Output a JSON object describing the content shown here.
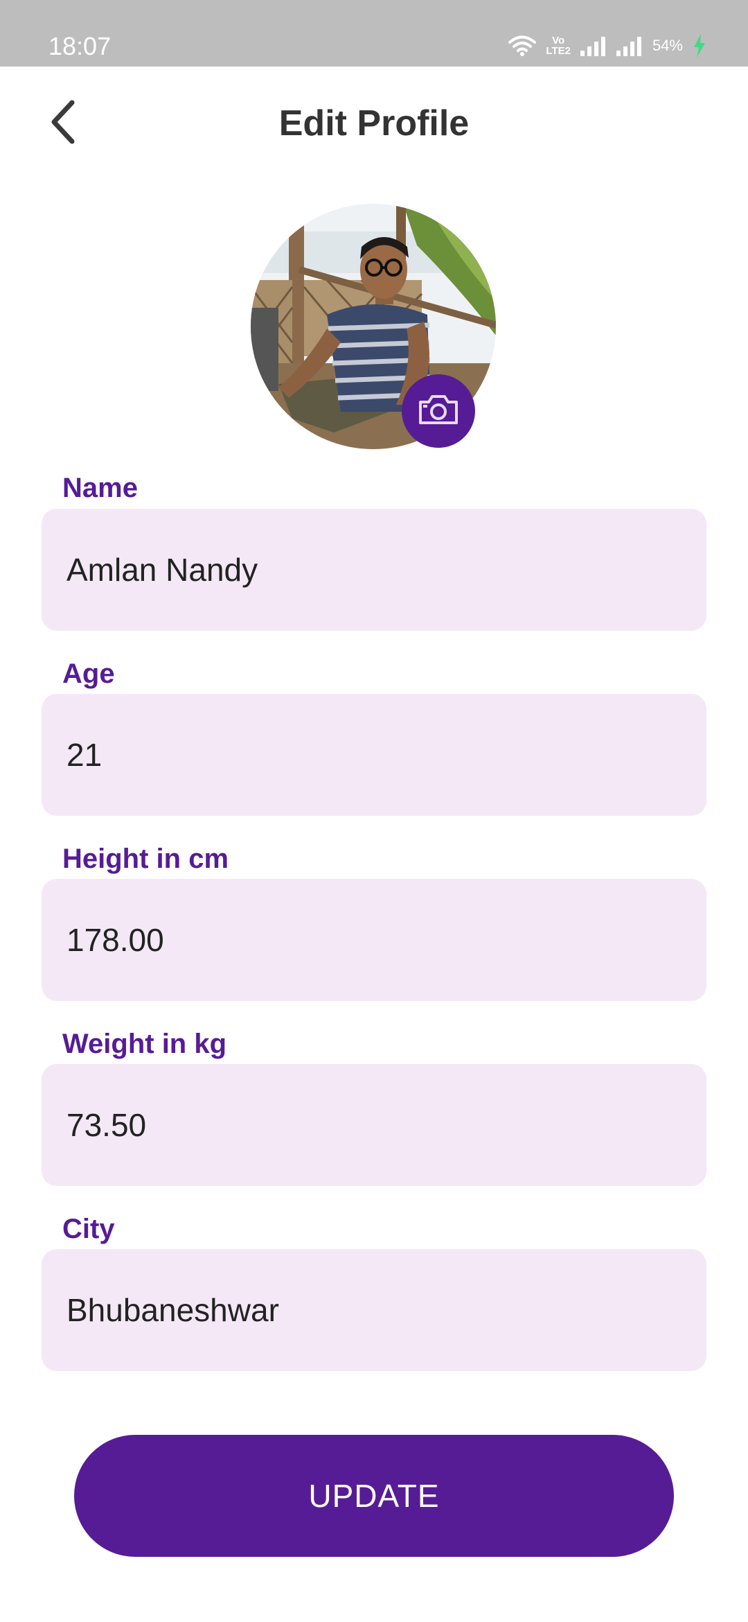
{
  "status_bar": {
    "time": "18:07",
    "battery": "54%",
    "network_label_top": "Vo",
    "network_label_bottom": "LTE2"
  },
  "header": {
    "title": "Edit Profile"
  },
  "profile": {
    "fields": [
      {
        "label": "Name",
        "value": "Amlan Nandy"
      },
      {
        "label": "Age",
        "value": "21"
      },
      {
        "label": "Height in cm",
        "value": "178.00"
      },
      {
        "label": "Weight in kg",
        "value": "73.50"
      },
      {
        "label": "City",
        "value": "Bhubaneshwar"
      }
    ]
  },
  "actions": {
    "update_label": "UPDATE"
  },
  "colors": {
    "accent": "#561c96",
    "field_bg": "#f4e8f6",
    "status_bar": "#bdbdbd"
  },
  "icons": {
    "back": "chevron-left-icon",
    "camera": "camera-icon",
    "wifi": "wifi-icon",
    "signal": "signal-icon",
    "battery": "charging-icon"
  }
}
